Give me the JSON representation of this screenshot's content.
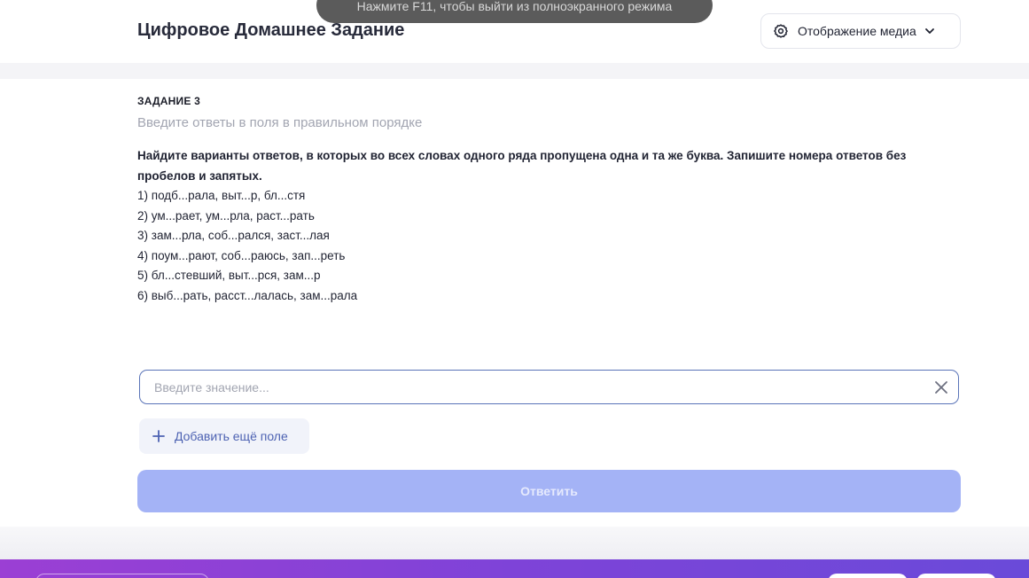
{
  "header": {
    "title": "Цифровое Домашнее Задание",
    "media_button_label": "Отображение медиа",
    "media_button_icon": "gear-icon",
    "media_chevron_icon": "chevron-down-icon"
  },
  "fullscreen_toast": "Нажмите F11, чтобы выйти из полноэкранного режима",
  "task": {
    "label": "ЗАДАНИЕ 3",
    "hint": "Введите ответы в поля в правильном порядке",
    "question": "Найдите варианты ответов, в которых во всех словах одного ряда пропущена одна и та же буква. Запишите номера ответов без пробелов и запятых.",
    "options": [
      "1) подб...рала, выт...р, бл...стя",
      "2) ум...рает, ум...рла, раст...рать",
      "3) зам...рла, соб...рался, заст...лая",
      "4) поум...рают, соб...раюсь, зап...реть",
      "5) бл...стевший, выт...рся, зам...р",
      "6) выб...рать, расст...лалась, зам...рала"
    ]
  },
  "answer": {
    "placeholder": "Введите значение...",
    "value": "",
    "clear_icon": "close-icon"
  },
  "add_field": {
    "label": "Добавить ещё поле",
    "icon": "plus-icon"
  },
  "submit": {
    "label": "Ответить"
  },
  "colors": {
    "accent": "#a4b3f6",
    "link": "#4d62b2",
    "input_border": "#5a74b8",
    "footer_start": "#9b3fd4",
    "footer_end": "#6a4ad9"
  }
}
